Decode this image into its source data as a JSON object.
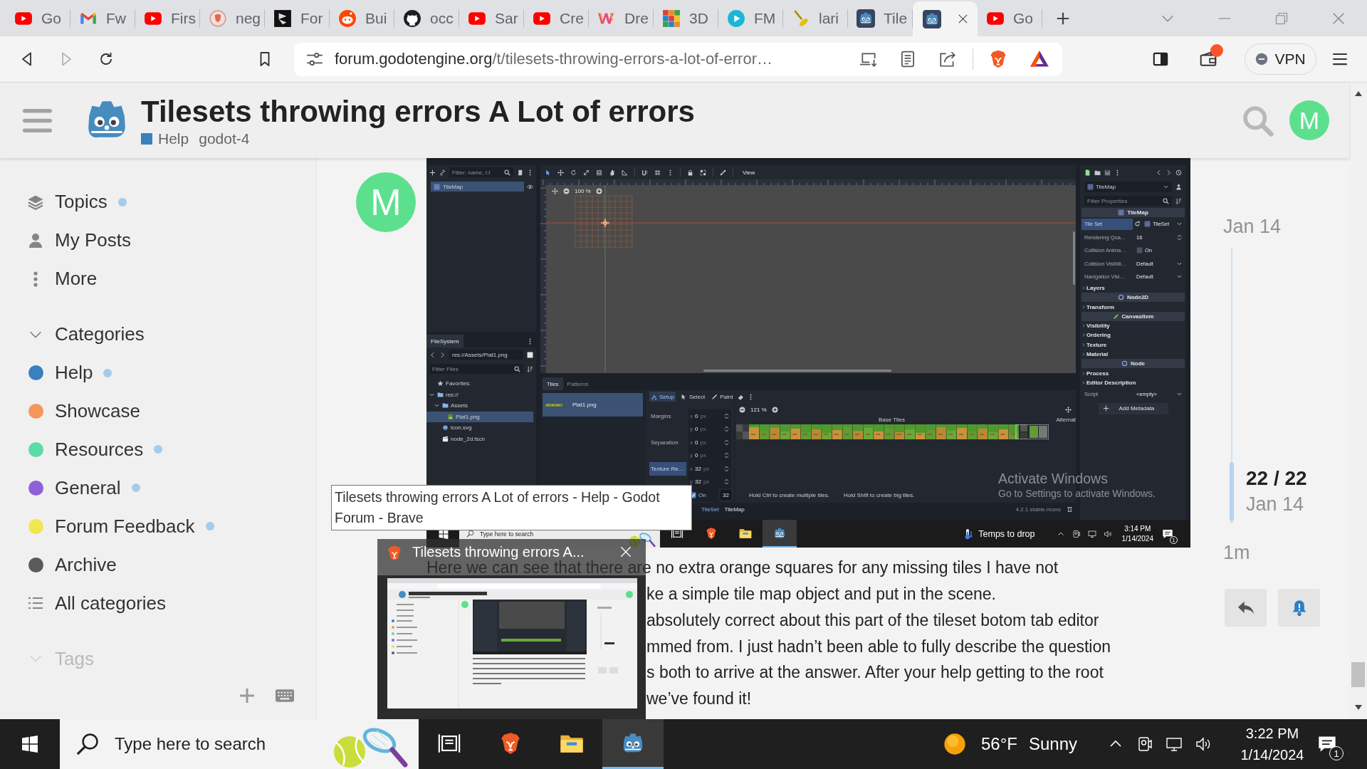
{
  "browser": {
    "tabs": [
      {
        "kind": "video",
        "label": "Go",
        "selected": false
      },
      {
        "kind": "mail",
        "label": "Fw",
        "selected": false
      },
      {
        "kind": "video",
        "label": "Firs",
        "selected": false
      },
      {
        "kind": "shield",
        "label": "neg",
        "selected": false
      },
      {
        "kind": "mark",
        "label": "For",
        "selected": false
      },
      {
        "kind": "alien",
        "label": "Bui",
        "selected": false
      },
      {
        "kind": "cat",
        "label": "occ",
        "selected": false
      },
      {
        "kind": "video",
        "label": "Sar",
        "selected": false
      },
      {
        "kind": "video",
        "label": "Cre",
        "selected": false
      },
      {
        "kind": "rainbow",
        "label": "Dre",
        "selected": false
      },
      {
        "kind": "blocks",
        "label": "3D",
        "selected": false
      },
      {
        "kind": "play",
        "label": "FM",
        "selected": false
      },
      {
        "kind": "brush",
        "label": "lari",
        "selected": false
      },
      {
        "kind": "robot",
        "label": "Tile",
        "selected": false
      },
      {
        "kind": "robot",
        "selected": true
      },
      {
        "kind": "video",
        "label": "Go",
        "selected": false
      }
    ],
    "back": {
      "disabled": false
    },
    "forward": {
      "disabled": true
    },
    "url": {
      "host": "forum.godotengine.org",
      "path": "/t/tilesets-throwing-errors-a-lot-of-error…"
    },
    "vpn": {
      "label": "VPN",
      "on": false
    }
  },
  "forum": {
    "title": "Tilesets throwing errors A Lot of errors",
    "category": {
      "name": "Help",
      "color": "#3a80c0"
    },
    "tags": [
      "godot-4"
    ],
    "user_initial": "M",
    "sidebar": {
      "links": [
        {
          "kind": "layers",
          "label": "Topics",
          "new": true
        },
        {
          "kind": "person",
          "label": "My Posts",
          "new": false
        },
        {
          "kind": "dots",
          "label": "More",
          "new": false
        }
      ],
      "categories_heading": {
        "label": "Categories",
        "expanded": true
      },
      "categories": [
        {
          "label": "Help",
          "color": "#3a80c0",
          "new": true
        },
        {
          "label": "Showcase",
          "color": "#f5965c",
          "new": false
        },
        {
          "label": "Resources",
          "color": "#5cdba8",
          "new": true
        },
        {
          "label": "General",
          "color": "#9060d8",
          "new": true
        },
        {
          "label": "Forum Feedback",
          "color": "#f0e64f",
          "new": true
        },
        {
          "label": "Archive",
          "color": "#5a5a5a",
          "new": false
        }
      ],
      "all_categories": "All categories",
      "tags_heading": "Tags"
    },
    "post": {
      "author_initial": "M",
      "screenshot": {
        "scene": {
          "filter_placeholder": "Filter: name, t:t",
          "nodes": [
            {
              "label": "TileMap",
              "selected": true
            }
          ]
        },
        "viewport": {
          "menu": "View",
          "zoom": "100 %"
        },
        "filesystem": {
          "tab": "FileSystem",
          "path": "res://Assets/Plat1.png",
          "filter_placeholder": "Filter Files",
          "tree": [
            {
              "kind": "star",
              "label": "Favorites:",
              "selected": false
            },
            {
              "kind": "folder",
              "label": "res://",
              "selected": false,
              "expanded": true,
              "children": [
                {
                  "kind": "folder",
                  "label": "Assets",
                  "selected": false,
                  "expanded": true,
                  "children": [
                    {
                      "kind": "image",
                      "label": "Plat1.png",
                      "selected": true
                    }
                  ]
                },
                {
                  "kind": "svg",
                  "label": "icon.svg",
                  "selected": false
                },
                {
                  "kind": "scene",
                  "label": "node_2d.tscn",
                  "selected": false
                }
              ]
            }
          ]
        },
        "tileset": {
          "tabs": [
            {
              "label": "Tiles",
              "selected": true
            },
            {
              "label": "Patterns",
              "selected": false
            }
          ],
          "sources": [
            {
              "label": "Plat1.png",
              "selected": true
            }
          ],
          "modes": [
            {
              "kind": "setup",
              "label": "Setup",
              "selected": true
            },
            {
              "kind": "select",
              "label": "Select",
              "selected": false
            },
            {
              "kind": "paint",
              "label": "Paint",
              "selected": false
            }
          ],
          "properties": [
            {
              "label": "Margins",
              "selected": false,
              "fields": [
                {
                  "axis": "x",
                  "value": "0",
                  "unit": "px"
                },
                {
                  "axis": "y",
                  "value": "0",
                  "unit": "px"
                }
              ]
            },
            {
              "label": "Separation",
              "selected": false,
              "fields": [
                {
                  "axis": "x",
                  "value": "0",
                  "unit": "px"
                },
                {
                  "axis": "y",
                  "value": "0",
                  "unit": "px"
                }
              ]
            },
            {
              "label": "Texture Re…",
              "selected": true,
              "fields": [
                {
                  "axis": "x",
                  "value": "32",
                  "unit": "px"
                },
                {
                  "axis": "y",
                  "value": "32",
                  "unit": "px"
                }
              ]
            }
          ],
          "padding": {
            "label": "On",
            "checked": true
          },
          "size": "32",
          "zoom": "121 %",
          "atlas_label": "Base Tiles",
          "alternate_label": "Alternat",
          "hints": [
            "Hold Ctrl to create multiple tiles.",
            "Hold Shift to create big tiles."
          ]
        },
        "editors": [
          {
            "label": "TileSet",
            "selected": true
          },
          {
            "label": "TileMap",
            "selected": false
          }
        ],
        "version": "4.2.1.stable.mono",
        "inspector": {
          "node": "TileMap",
          "filter_placeholder": "Filter Properties",
          "rows": [
            {
              "kind": "header",
              "label": "TileMap",
              "selected": false
            },
            {
              "kind": "resource",
              "label": "Tile Set",
              "value": "TileSet",
              "selected": true
            },
            {
              "kind": "number",
              "label": "Rendering Qua…",
              "value": "16",
              "selected": false
            },
            {
              "kind": "check",
              "label": "Collision Anima…",
              "value": "On",
              "checked": false,
              "selected": false
            },
            {
              "kind": "select",
              "label": "Collision Visibili…",
              "value": "Default",
              "selected": false
            },
            {
              "kind": "select",
              "label": "Navigation Visi…",
              "value": "Default",
              "selected": false
            },
            {
              "kind": "group",
              "label": "Layers",
              "selected": false
            },
            {
              "kind": "header",
              "label": "Node2D",
              "selected": false
            },
            {
              "kind": "group",
              "label": "Transform",
              "selected": false
            },
            {
              "kind": "header",
              "label": "CanvasItem",
              "selected": false
            },
            {
              "kind": "group",
              "label": "Visibility",
              "selected": false
            },
            {
              "kind": "group",
              "label": "Ordering",
              "selected": false
            },
            {
              "kind": "group",
              "label": "Texture",
              "selected": false
            },
            {
              "kind": "group",
              "label": "Material",
              "selected": false
            },
            {
              "kind": "header",
              "label": "Node",
              "selected": false
            },
            {
              "kind": "group",
              "label": "Process",
              "selected": false
            },
            {
              "kind": "group",
              "label": "Editor Description",
              "selected": false
            },
            {
              "kind": "select",
              "label": "Script",
              "value": "<empty>",
              "selected": false
            },
            {
              "kind": "button",
              "label": "Add Metadata",
              "selected": false
            }
          ]
        },
        "watermark": {
          "title": "Activate Windows",
          "hint": "Go to Settings to activate Windows."
        },
        "taskbar": {
          "search_placeholder": "Type here to search",
          "apps": [
            {
              "kind": "taskview",
              "selected": false
            },
            {
              "kind": "lion",
              "selected": false
            },
            {
              "kind": "folder",
              "selected": false
            },
            {
              "kind": "robot",
              "selected": true
            }
          ],
          "weather": "Temps to drop",
          "time": "3:14 PM",
          "date": "1/14/2024",
          "notifications": "1"
        }
      },
      "lines": [
        "Here we can see that there are no extra orange squares for any missing tiles I have not",
        "ke a simple tile map object and put in the scene.",
        "absolutely correct about this part of the tileset botom tab editor",
        "mmed from. I just hadn’t been able to fully describe the question",
        "s both to arrive at the answer. After your help getting to the root",
        "we’ve found it!"
      ]
    },
    "timeline": {
      "start": "Jan 14",
      "position": "22 / 22",
      "position_date": "Jan 14",
      "end": "1m"
    }
  },
  "tooltip": "Tilesets throwing errors A Lot of errors - Help - Godot Forum - Brave",
  "preview": {
    "title": "Tilesets throwing errors A..."
  },
  "taskbar": {
    "search_placeholder": "Type here to search",
    "apps": [
      {
        "kind": "taskview",
        "selected": false
      },
      {
        "kind": "lion",
        "selected": false
      },
      {
        "kind": "folder",
        "selected": false
      },
      {
        "kind": "robot",
        "selected": true
      }
    ],
    "temperature": "56°F",
    "condition": "Sunny",
    "time": "3:22 PM",
    "date": "1/14/2024",
    "notifications": "1"
  }
}
